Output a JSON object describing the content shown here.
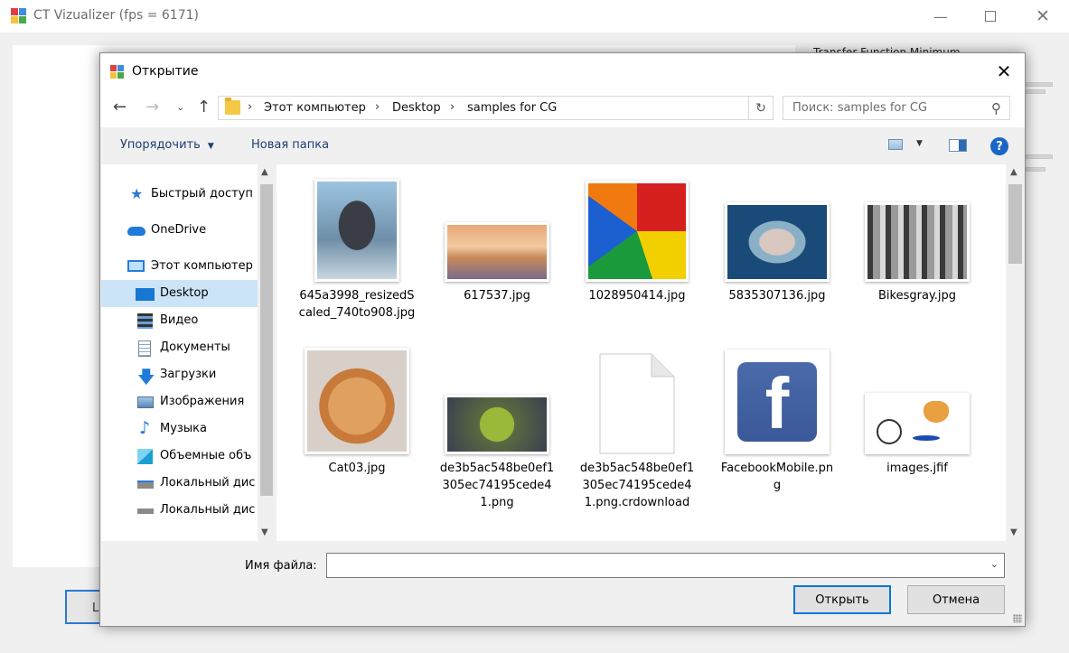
{
  "main_window": {
    "title": "CT Vizualizer (fps = 6171)",
    "panel_label": "Transfer Function Minimum",
    "bottom_button_label": "L"
  },
  "dialog": {
    "title": "Открытие",
    "address": {
      "crumbs": [
        "Этот компьютер",
        "Desktop",
        "samples for CG"
      ]
    },
    "search_placeholder": "Поиск: samples for CG",
    "toolbar": {
      "organize": "Упорядочить",
      "new_folder": "Новая папка"
    },
    "nav_items": [
      {
        "label": "Быстрый доступ",
        "icon": "star-icon"
      },
      {
        "label": "OneDrive",
        "icon": "cloud-icon"
      },
      {
        "label": "Этот компьютер",
        "icon": "computer-icon"
      },
      {
        "label": "Desktop",
        "icon": "desktop-icon",
        "selected": true
      },
      {
        "label": "Видео",
        "icon": "video-icon"
      },
      {
        "label": "Документы",
        "icon": "documents-icon"
      },
      {
        "label": "Загрузки",
        "icon": "downloads-icon"
      },
      {
        "label": "Изображения",
        "icon": "pictures-icon"
      },
      {
        "label": "Музыка",
        "icon": "music-icon"
      },
      {
        "label": "Объемные объ",
        "icon": "3d-objects-icon"
      },
      {
        "label": "Локальный дис",
        "icon": "local-disk-icon"
      },
      {
        "label": "Локальный дис",
        "icon": "local-disk-icon"
      }
    ],
    "files": [
      {
        "name": "645a3998_resizedScaled_740to908.jpg",
        "thumb": "seal-photo"
      },
      {
        "name": "617537.jpg",
        "thumb": "sunset-landscape"
      },
      {
        "name": "1028950414.jpg",
        "thumb": "rubiks-cube"
      },
      {
        "name": "5835307136.jpg",
        "thumb": "aerial-island"
      },
      {
        "name": "Bikesgray.jpg",
        "thumb": "bikes-grayscale"
      },
      {
        "name": "Cat03.jpg",
        "thumb": "cat-photo"
      },
      {
        "name": "de3b5ac548be0ef1305ec74195cede41.png",
        "thumb": "shrek-image"
      },
      {
        "name": "de3b5ac548be0ef1305ec74195cede41.png.crdownload",
        "thumb": "blank-file-icon"
      },
      {
        "name": "FacebookMobile.png",
        "thumb": "facebook-logo"
      },
      {
        "name": "images.jfif",
        "thumb": "teapot-drawing"
      }
    ],
    "filename_label": "Имя файла:",
    "filename_value": "",
    "open_button": "Открыть",
    "cancel_button": "Отмена",
    "colors": {
      "accent": "#0078d7",
      "selected_bg": "#cce4f7",
      "link_text": "#1a3e72"
    }
  }
}
